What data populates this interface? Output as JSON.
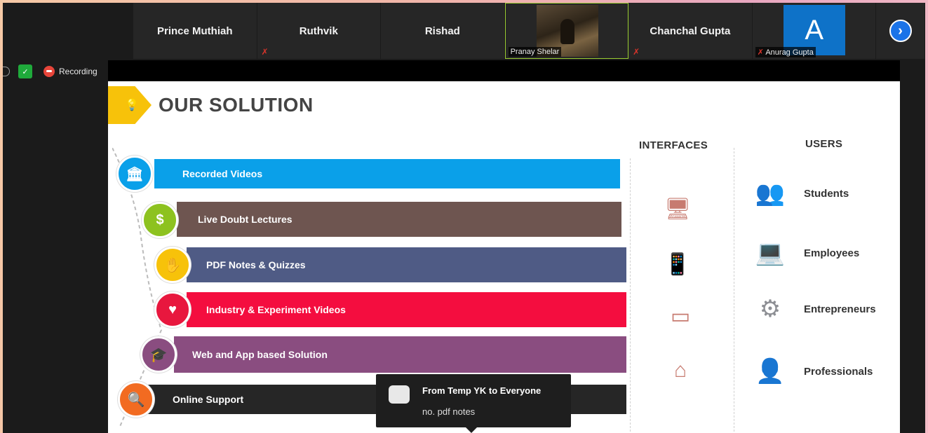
{
  "participants": [
    {
      "name": "Prince Muthiah"
    },
    {
      "name": "Ruthvik",
      "muted": true
    },
    {
      "name": "Rishad"
    },
    {
      "name": "Pranay Shelar",
      "video": true
    },
    {
      "name": "Chanchal Gupta",
      "muted": true
    },
    {
      "name": "Anurag Gupta",
      "avatar_letter": "A",
      "muted": true
    }
  ],
  "next_icon": "chevron-right-icon",
  "status": {
    "recording_label": "Recording"
  },
  "slide": {
    "title": "OUR SOLUTION",
    "solutions": [
      {
        "label": "Recorded Videos",
        "color": "#0aa0e9"
      },
      {
        "label": "Live Doubt Lectures",
        "color": "#6e5550"
      },
      {
        "label": "PDF Notes & Quizzes",
        "color": "#4f5b85"
      },
      {
        "label": "Industry & Experiment Videos",
        "color": "#f40d3f"
      },
      {
        "label": "Web and App based Solution",
        "color": "#8a4d80"
      },
      {
        "label": "Online Support",
        "color": "#262626"
      }
    ],
    "circle_colors": [
      "#0aa0e9",
      "#8dc21f",
      "#f7c20a",
      "#e8173e",
      "#8a4d80",
      "#f26b21"
    ],
    "interfaces_heading": "INTERFACES",
    "users_heading": "USERS",
    "users": [
      {
        "label": "Students",
        "icon": "group-icon"
      },
      {
        "label": "Employees",
        "icon": "desk-workers-icon"
      },
      {
        "label": "Entrepreneurs",
        "icon": "head-gears-icon"
      },
      {
        "label": "Professionals",
        "icon": "team-icon"
      }
    ],
    "interface_icons": [
      "desktop-icon",
      "mobile-icon",
      "tablet-icon",
      "wifi-monitor-icon"
    ]
  },
  "chat": {
    "from": "From Temp YK to Everyone",
    "message": "no. pdf notes"
  }
}
